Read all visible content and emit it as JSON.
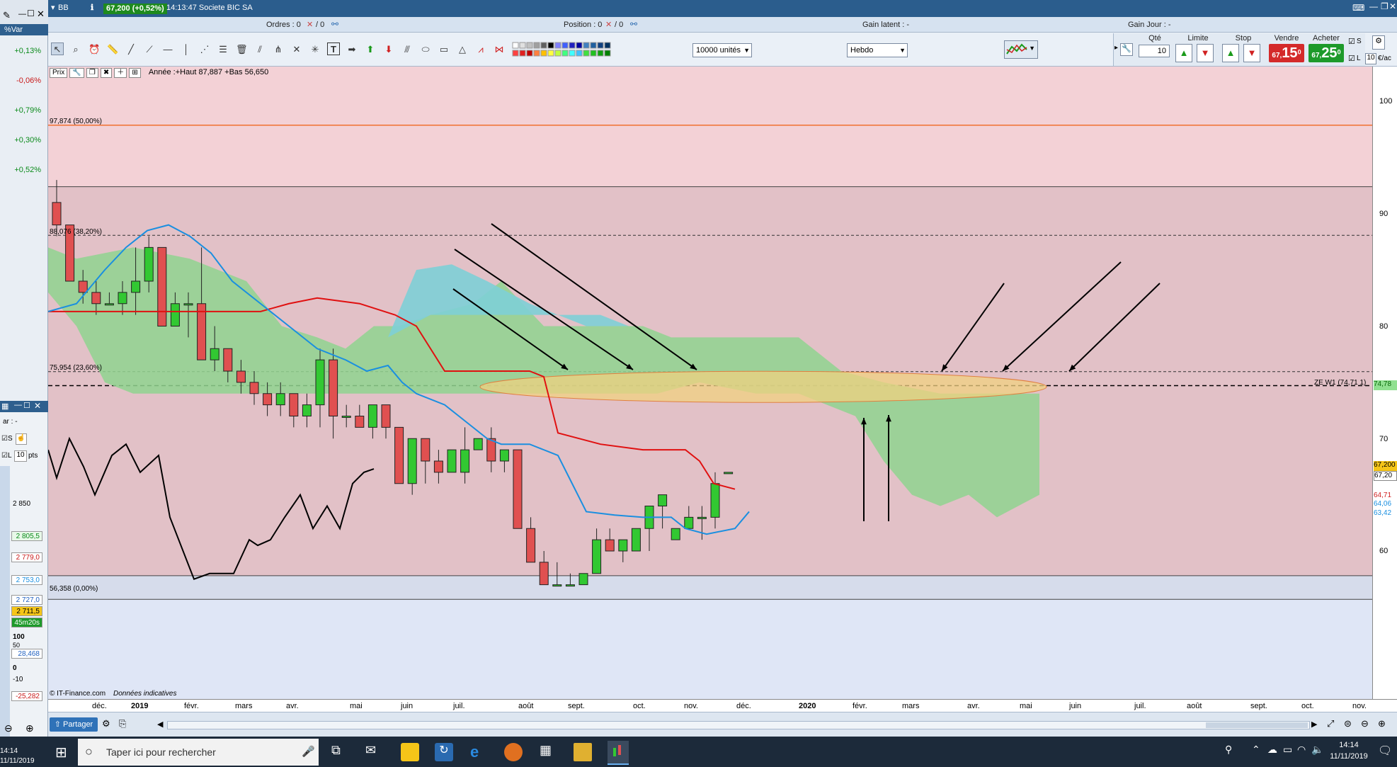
{
  "window": {
    "symbol": "BB",
    "price_badge": "67,200 (+0,52%)",
    "title": "14:13:47  Societe BIC SA"
  },
  "infobar": {
    "orders": "Ordres : 0",
    "orders_total": "/ 0",
    "position": "Position : 0",
    "position_total": "/ 0",
    "gain_latent": "Gain latent : -",
    "gain_jour": "Gain Jour : -"
  },
  "toolbar": {
    "units_select": "10000 unités",
    "period_select": "Hebdo",
    "qty_label": "Qté",
    "qty_value": "10",
    "limite_label": "Limite",
    "stop_label": "Stop",
    "vendre_label": "Vendre",
    "acheter_label": "Acheter",
    "sell_price_small": "67,",
    "sell_price_big": "15",
    "sell_price_sup": "0",
    "buy_price_small": "67,",
    "buy_price_big": "25",
    "buy_price_sup": "0",
    "s_label": "S",
    "l_label": "L",
    "l_value": "10",
    "unit_suffix": "€/ac"
  },
  "left_panel": {
    "var_header": "%Var",
    "rows": [
      "+0,13%",
      "-0,06%",
      "+0,79%",
      "+0,30%",
      "+0,52%"
    ]
  },
  "mini_window": {
    "var_label": "ar : -",
    "s_label": "S",
    "l_label": "L",
    "l_value": "10",
    "pts_label": "pts",
    "y_2850": "2 850",
    "tag_2805": "2 805,5",
    "tag_2779": "2 779,0",
    "tag_2753": "2 753,0",
    "tag_2727": "2 727,0",
    "tag_2711": "2 711,5",
    "time_tag": "45m20s",
    "ind_100": "100",
    "ind_50": "50",
    "tag_28": "28,468",
    "ind_0": "0",
    "ind_m10": "-10",
    "tag_m25": "-25,282"
  },
  "chart": {
    "header_label": "Prix",
    "header_info": "Année :+Haut 87,887 +Bas 56,650",
    "fib_50": "97,874 (50,00%)",
    "fib_382": "88,076 (38,20%)",
    "fib_236": "75,954 (23,60%)",
    "fib_0": "56,358 (0,00%)",
    "zone_label": "ZE W1 (74,71 1)",
    "copyright": "© IT-Finance.com",
    "disclaimer": "Données indicatives",
    "tag_current": "67,200",
    "tag_current2": "67,20",
    "tag_red": "64,71",
    "tag_cyan1": "64,06",
    "tag_cyan2": "63,42",
    "tag_zone": "74,78"
  },
  "chart_data": {
    "type": "candlestick",
    "title": "",
    "y_ticks": [
      100,
      90,
      80,
      70,
      60
    ],
    "x_ticks": [
      "déc.",
      "2019",
      "févr.",
      "mars",
      "avr.",
      "mai",
      "juin",
      "juil.",
      "août",
      "sept.",
      "oct.",
      "nov.",
      "déc.",
      "2020",
      "févr.",
      "mars",
      "avr.",
      "mai",
      "juin",
      "juil.",
      "août",
      "sept.",
      "oct.",
      "nov."
    ],
    "ylim": [
      47,
      107
    ],
    "colors": {
      "up": "#32c832",
      "down": "#e05050",
      "tenkan": "#e01010",
      "kijun": "#1a8fe0",
      "chikou": "#000000"
    },
    "candles": [
      [
        91,
        93,
        88,
        89
      ],
      [
        89,
        89,
        84,
        84
      ],
      [
        84,
        85,
        82,
        83
      ],
      [
        83,
        84,
        81,
        82
      ],
      [
        82,
        83,
        82,
        82
      ],
      [
        82,
        84,
        81,
        83
      ],
      [
        83,
        87,
        81,
        84
      ],
      [
        84,
        88,
        83,
        87
      ],
      [
        87,
        87,
        80,
        80
      ],
      [
        80,
        83,
        80,
        82
      ],
      [
        82,
        83,
        79,
        82
      ],
      [
        82,
        87,
        77,
        77
      ],
      [
        77,
        80,
        76,
        78
      ],
      [
        78,
        78,
        75,
        76
      ],
      [
        76,
        77,
        74,
        75
      ],
      [
        75,
        76,
        73,
        74
      ],
      [
        74,
        75,
        72,
        73
      ],
      [
        73,
        75,
        72,
        74
      ],
      [
        74,
        74,
        71,
        72
      ],
      [
        72,
        74,
        71,
        73
      ],
      [
        73,
        78,
        71,
        77
      ],
      [
        77,
        78,
        70,
        72
      ],
      [
        72,
        73,
        71,
        72
      ],
      [
        72,
        73,
        71,
        71
      ],
      [
        71,
        73,
        70,
        73
      ],
      [
        73,
        73,
        70,
        71
      ],
      [
        71,
        71,
        66,
        66
      ],
      [
        66,
        70,
        65,
        70
      ],
      [
        70,
        70,
        66,
        68
      ],
      [
        68,
        69,
        66,
        67
      ],
      [
        67,
        69,
        67,
        69
      ],
      [
        67,
        71,
        66,
        69
      ],
      [
        69,
        70,
        69,
        70
      ],
      [
        70,
        71,
        67,
        68
      ],
      [
        68,
        69,
        67,
        69
      ],
      [
        69,
        69,
        62,
        62
      ],
      [
        62,
        63,
        59,
        59
      ],
      [
        59,
        60,
        57,
        57
      ],
      [
        57,
        59,
        57,
        57
      ],
      [
        57,
        58,
        57,
        57
      ],
      [
        57,
        58,
        57,
        58
      ],
      [
        58,
        62,
        58,
        61
      ],
      [
        61,
        62,
        60,
        60
      ],
      [
        60,
        61,
        59,
        61
      ],
      [
        60,
        62,
        60,
        62
      ],
      [
        62,
        63,
        60,
        64
      ],
      [
        64,
        65,
        62,
        65
      ],
      [
        61,
        62,
        61,
        62
      ],
      [
        62,
        64,
        62,
        63
      ],
      [
        63,
        64,
        61,
        63
      ],
      [
        63,
        67,
        62,
        66
      ],
      [
        67,
        67,
        67,
        67
      ]
    ],
    "fib_levels": [
      {
        "label": "50,00%",
        "value": 97.874
      },
      {
        "label": "38,20%",
        "value": 88.076
      },
      {
        "label": "23,60%",
        "value": 75.954
      },
      {
        "label": "0,00%",
        "value": 56.358
      }
    ],
    "zone_line": 74.71
  },
  "xaxis": [
    "déc.",
    "2019",
    "févr.",
    "mars",
    "avr.",
    "mai",
    "juin",
    "juil.",
    "août",
    "sept.",
    "oct.",
    "nov.",
    "déc.",
    "2020",
    "févr.",
    "mars",
    "avr.",
    "mai",
    "juin",
    "juil.",
    "août",
    "sept.",
    "oct.",
    "nov."
  ],
  "yaxis": [
    "100",
    "90",
    "80",
    "70",
    "60"
  ],
  "bottom": {
    "share": "Partager"
  },
  "taskbar": {
    "search": "Taper ici pour rechercher",
    "time": "14:14",
    "date": "11/11/2019",
    "left_time": "14:14",
    "left_date": "11/11/2019"
  }
}
